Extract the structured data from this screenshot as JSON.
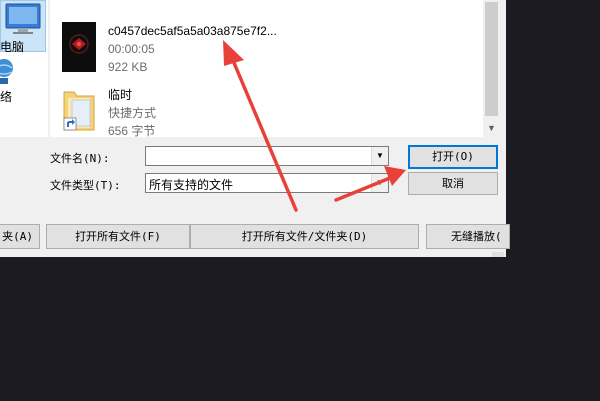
{
  "sidebar": {
    "items": [
      {
        "label": "电脑",
        "icon": "computer-icon"
      },
      {
        "label": "络",
        "icon": "network-icon"
      }
    ]
  },
  "files": [
    {
      "name": "c0457dec5af5a5a03a875e7f2...",
      "line2": "00:00:05",
      "line3": "922 KB",
      "icon": "video-thumbnail"
    },
    {
      "name": "临时",
      "line2": "快捷方式",
      "line3": "656 字节",
      "icon": "folder-shortcut-icon"
    }
  ],
  "form": {
    "filename_label": "文件名(N):",
    "filename_value": "",
    "filetype_label": "文件类型(T):",
    "filetype_value": "所有支持的文件"
  },
  "buttons": {
    "open": "打开(O)",
    "cancel": "取消",
    "folder_partial": "夹(A)",
    "open_all_files": "打开所有文件(F)",
    "open_all_files_folders": "打开所有文件/文件夹(D)",
    "seamless_play": "无缝播放("
  },
  "colors": {
    "annotation_arrow": "#e8413a",
    "background_dark": "#1c1b22",
    "dialog_bg": "#f0f0f0",
    "primary_border": "#0078d7"
  }
}
